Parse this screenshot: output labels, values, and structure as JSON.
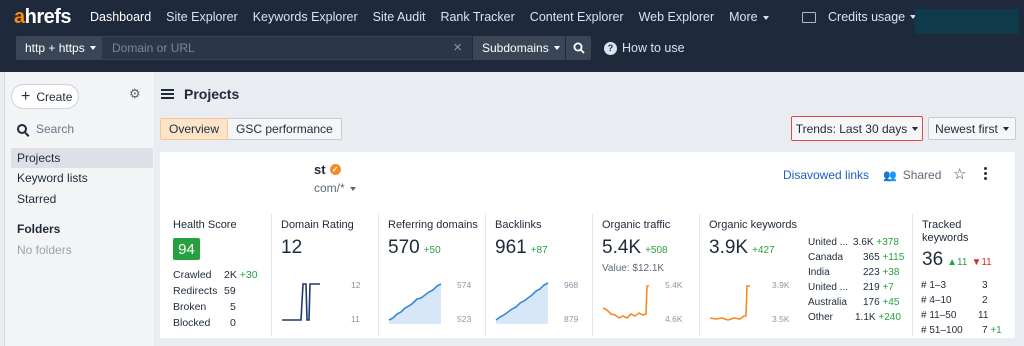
{
  "topbar": {
    "logo_prefix": "a",
    "logo_rest": "hrefs",
    "nav": [
      "Dashboard",
      "Site Explorer",
      "Keywords Explorer",
      "Site Audit",
      "Rank Tracker",
      "Content Explorer",
      "Web Explorer",
      "More"
    ],
    "credits_label": "Credits usage"
  },
  "search": {
    "protocol": "http + https",
    "placeholder": "Domain or URL",
    "mode": "Subdomains",
    "how_to_use": "How to use"
  },
  "sidebar": {
    "create_label": "Create",
    "search_label": "Search",
    "items": [
      "Projects",
      "Keyword lists",
      "Starred"
    ],
    "folders_heading": "Folders",
    "folders_empty": "No folders"
  },
  "page": {
    "title": "Projects",
    "tabs": [
      "Overview",
      "GSC performance"
    ],
    "trends_filter": "Trends: Last 30 days",
    "sort": "Newest first"
  },
  "project": {
    "name": "st",
    "url": "com/*",
    "disavowed_label": "Disavowed links",
    "shared_label": "Shared",
    "health": {
      "label": "Health Score",
      "value": "94",
      "rows": [
        {
          "label": "Crawled",
          "value": "2K",
          "delta": "+30"
        },
        {
          "label": "Redirects",
          "value": "59",
          "delta": ""
        },
        {
          "label": "Broken",
          "value": "5",
          "delta": ""
        },
        {
          "label": "Blocked",
          "value": "0",
          "delta": ""
        }
      ]
    },
    "domain_rating": {
      "label": "Domain Rating",
      "value": "12",
      "ymax": "12",
      "ymin": "11"
    },
    "referring_domains": {
      "label": "Referring domains",
      "value": "570",
      "delta": "+50",
      "ymax": "574",
      "ymin": "523"
    },
    "backlinks": {
      "label": "Backlinks",
      "value": "961",
      "delta": "+87",
      "ymax": "968",
      "ymin": "879"
    },
    "organic_traffic": {
      "label": "Organic traffic",
      "value": "5.4K",
      "delta": "+508",
      "value_label": "Value: $12.1K",
      "ymax": "5.4K",
      "ymin": "4.6K"
    },
    "organic_keywords": {
      "label": "Organic keywords",
      "value": "3.9K",
      "delta": "+427",
      "ymax": "3.9K",
      "ymin": "3.5K"
    },
    "countries": [
      {
        "name": "United ...",
        "value": "3.6K",
        "delta": "+378"
      },
      {
        "name": "Canada",
        "value": "365",
        "delta": "+115"
      },
      {
        "name": "India",
        "value": "223",
        "delta": "+38"
      },
      {
        "name": "United ...",
        "value": "219",
        "delta": "+7"
      },
      {
        "name": "Australia",
        "value": "176",
        "delta": "+45"
      },
      {
        "name": "Other",
        "value": "1.1K",
        "delta": "+240"
      }
    ],
    "tracked": {
      "label_line1": "Tracked",
      "label_line2": "keywords",
      "value": "36",
      "up": "11",
      "down": "11",
      "rows": [
        {
          "label": "# 1–3",
          "value": "3",
          "delta": ""
        },
        {
          "label": "# 4–10",
          "value": "2",
          "delta": ""
        },
        {
          "label": "# 11–50",
          "value": "11",
          "delta": ""
        },
        {
          "label": "# 51–100",
          "value": "7",
          "delta": "+1"
        }
      ]
    }
  },
  "colors": {
    "accent": "#ff8800",
    "topbar": "#1e293b",
    "green": "#27a042",
    "red": "#d92d20",
    "link": "#1b5fc1"
  }
}
